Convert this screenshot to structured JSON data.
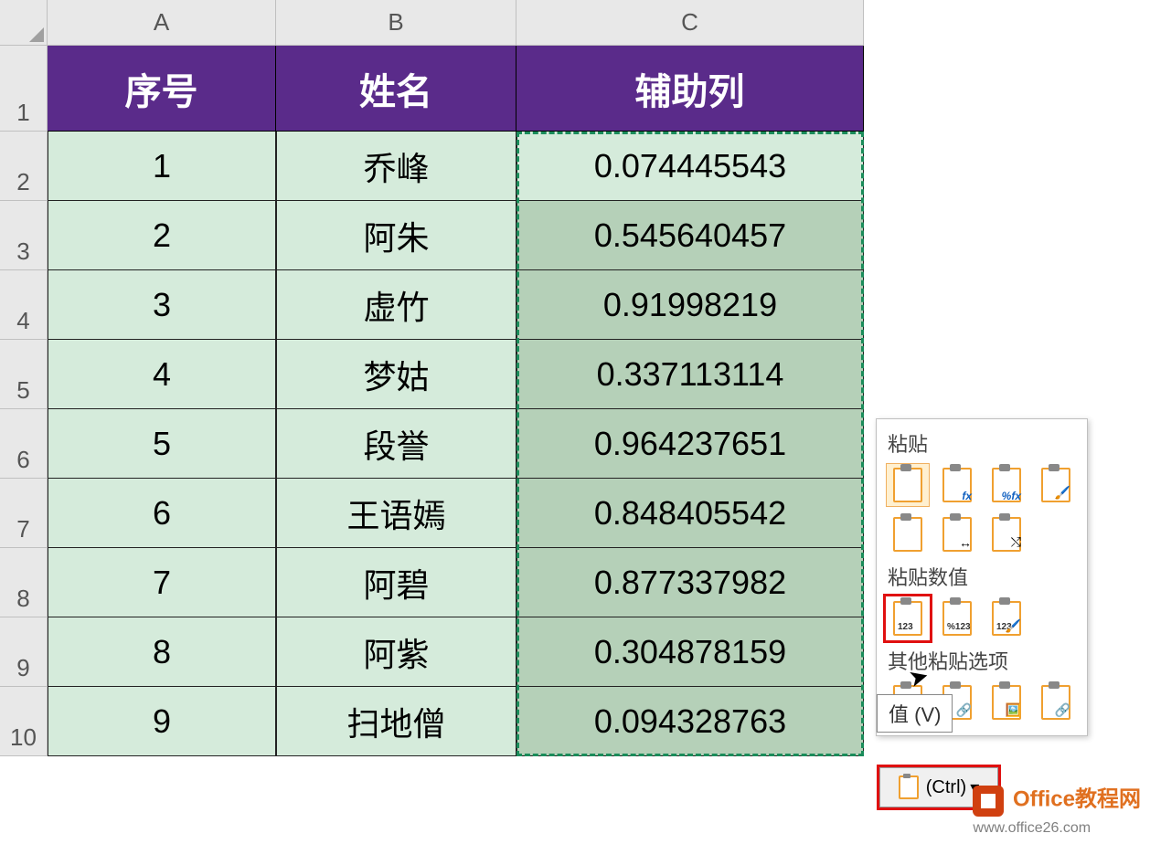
{
  "columns": [
    "A",
    "B",
    "C"
  ],
  "header": {
    "a": "序号",
    "b": "姓名",
    "c": "辅助列"
  },
  "rows": [
    {
      "r": "1"
    },
    {
      "r": "2",
      "a": "1",
      "b": "乔峰",
      "c": "0.074445543"
    },
    {
      "r": "3",
      "a": "2",
      "b": "阿朱",
      "c": "0.545640457"
    },
    {
      "r": "4",
      "a": "3",
      "b": "虚竹",
      "c": "0.91998219"
    },
    {
      "r": "5",
      "a": "4",
      "b": "梦姑",
      "c": "0.337113114"
    },
    {
      "r": "6",
      "a": "5",
      "b": "段誉",
      "c": "0.964237651"
    },
    {
      "r": "7",
      "a": "6",
      "b": "王语嫣",
      "c": "0.848405542"
    },
    {
      "r": "8",
      "a": "7",
      "b": "阿碧",
      "c": "0.877337982"
    },
    {
      "r": "9",
      "a": "8",
      "b": "阿紫",
      "c": "0.304878159"
    },
    {
      "r": "10",
      "a": "9",
      "b": "扫地僧",
      "c": "0.094328763"
    }
  ],
  "paste_menu": {
    "section_paste": "粘贴",
    "section_values": "粘贴数值",
    "section_other": "其他粘贴选项",
    "tooltip": "值 (V)",
    "ctrl_label": "(Ctrl)",
    "icons": {
      "r1": [
        "paste-icon",
        "paste-formulas-icon",
        "paste-formulas-number-icon",
        "paste-formatting-icon"
      ],
      "r2": [
        "paste-no-borders-icon",
        "paste-keep-width-icon",
        "paste-transpose-icon"
      ],
      "r3": [
        "paste-values-icon",
        "paste-values-number-icon",
        "paste-values-format-icon"
      ],
      "r4": [
        "paste-special-icon",
        "paste-link-icon",
        "paste-picture-icon",
        "paste-linked-picture-icon"
      ]
    },
    "sublabels": {
      "fx": "fx",
      "pfx": "%fx",
      "v123": "123",
      "vp": "%123",
      "vf": "123"
    }
  },
  "watermark": {
    "line1": "Office教程网",
    "line2": "www.office26.com"
  }
}
